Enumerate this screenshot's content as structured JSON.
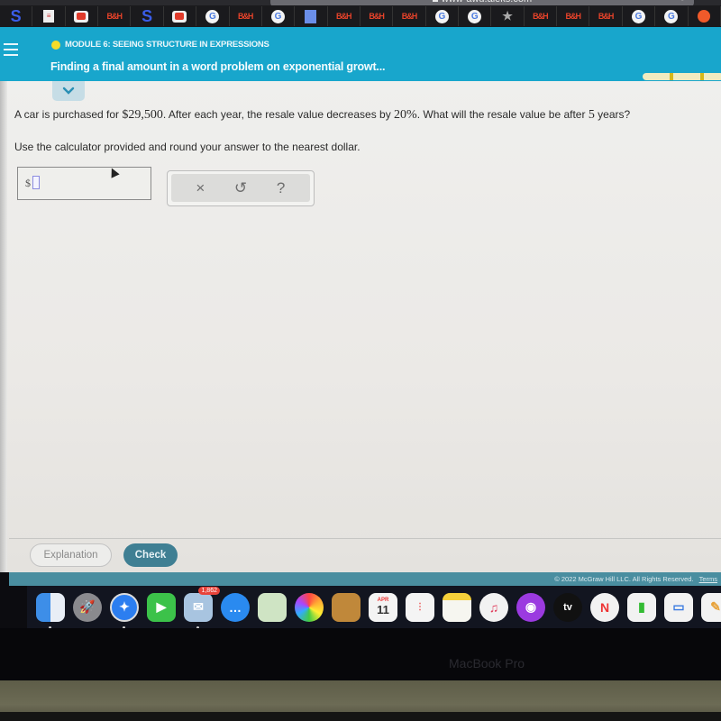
{
  "browser": {
    "url": "www-awu.aleks.com",
    "bookmarks": [
      {
        "icon": "s-icon"
      },
      {
        "icon": "mail-icon"
      },
      {
        "icon": "youtube-icon"
      },
      {
        "icon": "bh-icon",
        "label": "B&H"
      },
      {
        "icon": "s-icon"
      },
      {
        "icon": "youtube-icon"
      },
      {
        "icon": "google-icon"
      },
      {
        "icon": "bh-icon",
        "label": "B&H"
      },
      {
        "icon": "google-icon"
      },
      {
        "icon": "wm-icon"
      },
      {
        "icon": "bh-icon",
        "label": "B&H"
      },
      {
        "icon": "bh-icon",
        "label": "B&H"
      },
      {
        "icon": "bh-icon",
        "label": "B&H"
      },
      {
        "icon": "google-icon"
      },
      {
        "icon": "google-icon"
      },
      {
        "icon": "star-icon"
      },
      {
        "icon": "bh-icon",
        "label": "B&H"
      },
      {
        "icon": "bh-icon",
        "label": "B&H"
      },
      {
        "icon": "bh-icon",
        "label": "B&H"
      },
      {
        "icon": "google-icon"
      },
      {
        "icon": "google-icon"
      },
      {
        "icon": "reddit-icon"
      }
    ]
  },
  "header": {
    "module": "MODULE 6: SEEING STRUCTURE IN EXPRESSIONS",
    "topic": "Finding a final amount in a word problem on exponential growt...",
    "accent_color": "#18a6cc",
    "progress_fraction": 0.5
  },
  "question": {
    "text_before": "A car is purchased for ",
    "price": "$29,500",
    "text_middle": ". After each year, the resale value decreases by ",
    "rate": "20%",
    "text_after": ". What will the resale value be after ",
    "years": "5",
    "text_end": " years?",
    "instruction": "Use the calculator provided and round your answer to the nearest dollar."
  },
  "answer": {
    "prefix": "$",
    "value": ""
  },
  "tools": {
    "clear": "×",
    "undo": "↺",
    "help": "?"
  },
  "actions": {
    "explanation": "Explanation",
    "check": "Check"
  },
  "footer": {
    "copyright": "© 2022 McGraw Hill LLC. All Rights Reserved.",
    "terms": "Terms"
  },
  "dock": {
    "mail_badge": "1,862",
    "calendar_month": "APR",
    "calendar_day": "11",
    "tv_label": "tv"
  },
  "device": {
    "label": "MacBook Pro"
  }
}
